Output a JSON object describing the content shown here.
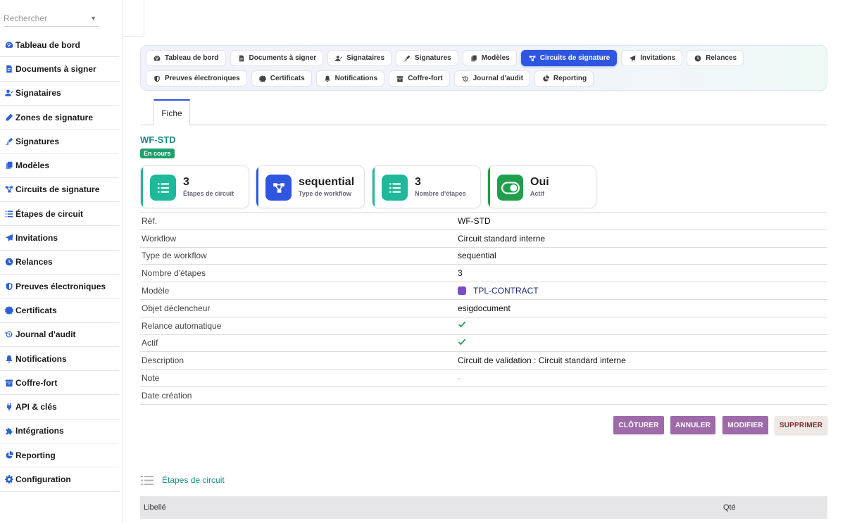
{
  "search": {
    "placeholder": "Rechercher"
  },
  "sidebar": {
    "items": [
      {
        "label": "Tableau de bord",
        "icon": "dashboard-icon"
      },
      {
        "label": "Documents à signer",
        "icon": "document-icon"
      },
      {
        "label": "Signataires",
        "icon": "users-icon"
      },
      {
        "label": "Zones de signature",
        "icon": "pen-icon"
      },
      {
        "label": "Signatures",
        "icon": "signature-icon"
      },
      {
        "label": "Modèles",
        "icon": "copy-icon"
      },
      {
        "label": "Circuits de signature",
        "icon": "workflow-icon"
      },
      {
        "label": "Étapes de circuit",
        "icon": "list-icon"
      },
      {
        "label": "Invitations",
        "icon": "send-icon"
      },
      {
        "label": "Relances",
        "icon": "clock-icon"
      },
      {
        "label": "Preuves électroniques",
        "icon": "shield-icon"
      },
      {
        "label": "Certificats",
        "icon": "certificate-icon"
      },
      {
        "label": "Journal d'audit",
        "icon": "history-icon"
      },
      {
        "label": "Notifications",
        "icon": "bell-icon"
      },
      {
        "label": "Coffre-fort",
        "icon": "archive-icon"
      },
      {
        "label": "API & clés",
        "icon": "plug-icon"
      },
      {
        "label": "Intégrations",
        "icon": "puzzle-icon"
      },
      {
        "label": "Reporting",
        "icon": "chart-pie-icon"
      },
      {
        "label": "Configuration",
        "icon": "gear-icon"
      }
    ]
  },
  "tabs": {
    "items": [
      {
        "label": "Tableau de bord",
        "icon": "dashboard-icon",
        "active": false
      },
      {
        "label": "Documents à signer",
        "icon": "document-icon",
        "active": false
      },
      {
        "label": "Signataires",
        "icon": "users-icon",
        "active": false
      },
      {
        "label": "Signatures",
        "icon": "signature-icon",
        "active": false
      },
      {
        "label": "Modèles",
        "icon": "copy-icon",
        "active": false
      },
      {
        "label": "Circuits de signature",
        "icon": "workflow-icon",
        "active": true
      },
      {
        "label": "Invitations",
        "icon": "send-icon",
        "active": false
      },
      {
        "label": "Relances",
        "icon": "clock-icon",
        "active": false
      },
      {
        "label": "Preuves électroniques",
        "icon": "shield-icon",
        "active": false
      },
      {
        "label": "Certificats",
        "icon": "certificate-icon",
        "active": false
      },
      {
        "label": "Notifications",
        "icon": "bell-icon",
        "active": false
      },
      {
        "label": "Coffre-fort",
        "icon": "archive-icon",
        "active": false
      },
      {
        "label": "Journal d'audit",
        "icon": "history-icon",
        "active": false
      },
      {
        "label": "Reporting",
        "icon": "chart-pie-icon",
        "active": false
      }
    ]
  },
  "subtabs": {
    "fiche": "Fiche"
  },
  "record": {
    "title": "WF-STD",
    "status": "En cours"
  },
  "stats": [
    {
      "value": "3",
      "label": "Étapes de circuit",
      "icon": "list-icon",
      "color": "#20b89a"
    },
    {
      "value": "sequential",
      "label": "Type de workflow",
      "icon": "workflow-icon",
      "color": "#2f56e0"
    },
    {
      "value": "3",
      "label": "Nombre d'étapes",
      "icon": "list-icon",
      "color": "#20b89a"
    },
    {
      "value": "Oui",
      "label": "Actif",
      "icon": "toggle-on-icon",
      "color": "#1f9f4b"
    }
  ],
  "fields": [
    {
      "key": "Réf.",
      "value": "WF-STD",
      "type": "text"
    },
    {
      "key": "Workflow",
      "value": "Circuit standard interne",
      "type": "text"
    },
    {
      "key": "Type de workflow",
      "value": "sequential",
      "type": "text"
    },
    {
      "key": "Nombre d'étapes",
      "value": "3",
      "type": "text"
    },
    {
      "key": "Modèle",
      "value": "TPL-CONTRACT",
      "type": "link"
    },
    {
      "key": "Objet déclencheur",
      "value": "esigdocument",
      "type": "text"
    },
    {
      "key": "Relance automatique",
      "value": "",
      "type": "check"
    },
    {
      "key": "Actif",
      "value": "",
      "type": "check"
    },
    {
      "key": "Description",
      "value": "Circuit de validation : Circuit standard interne",
      "type": "text"
    },
    {
      "key": "Note",
      "value": "-",
      "type": "dash"
    },
    {
      "key": "Date création",
      "value": "",
      "type": "text"
    }
  ],
  "actions": {
    "close": "CLÔTURER",
    "cancel": "ANNULER",
    "edit": "MODIFIER",
    "delete": "SUPPRIMER"
  },
  "steps_section": {
    "title": "Étapes de circuit",
    "columns": [
      "Libellé",
      "Qté"
    ]
  }
}
